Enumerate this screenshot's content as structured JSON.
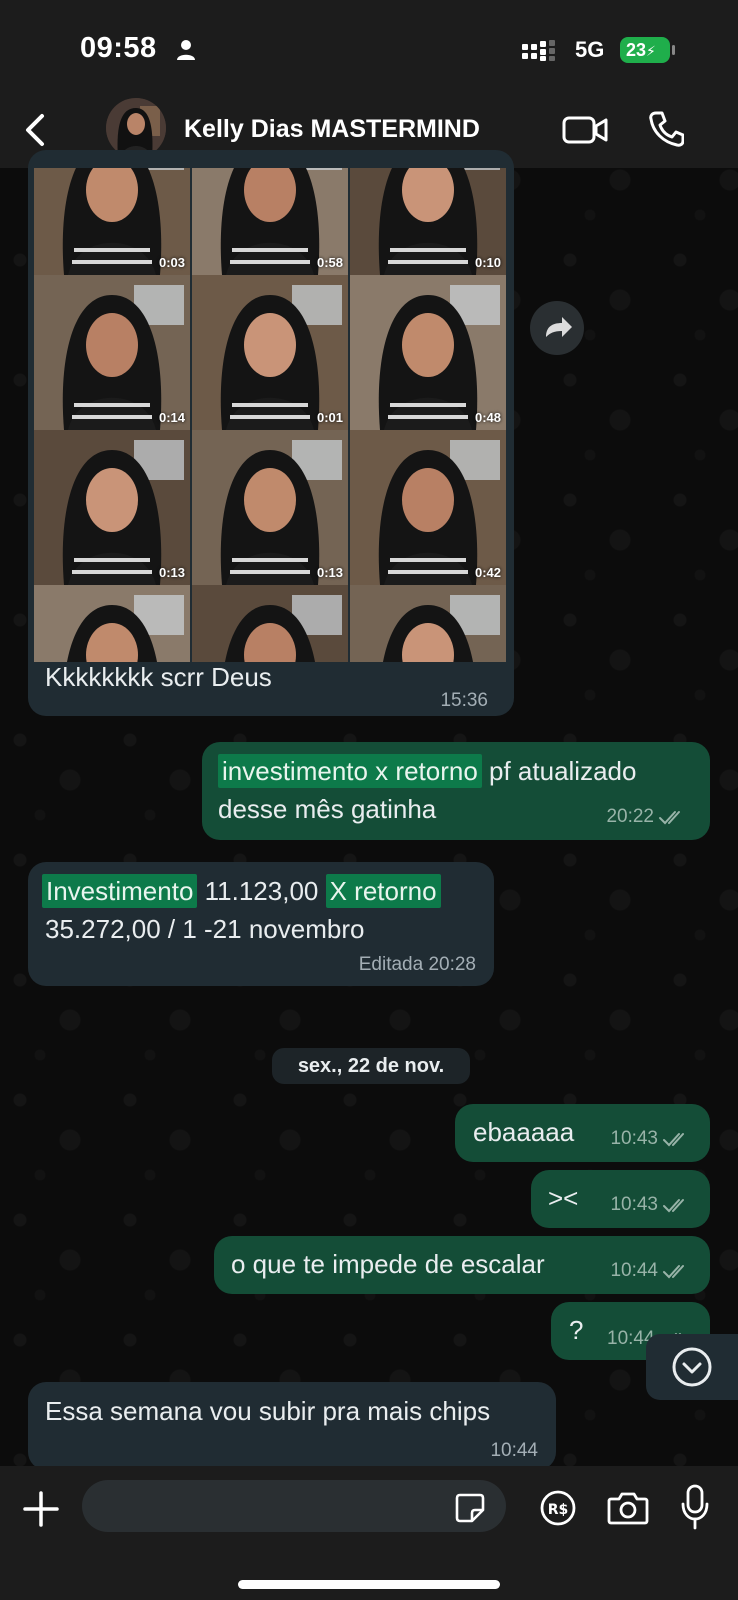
{
  "status_bar": {
    "time": "09:58",
    "network": "5G",
    "battery": "23",
    "icons": [
      "person-icon",
      "signal-icon",
      "battery-charging-icon"
    ]
  },
  "header": {
    "contact_name": "Kelly Dias MASTERMIND",
    "icons": [
      "back-chevron-icon",
      "avatar",
      "video-call-icon",
      "phone-icon"
    ]
  },
  "media_album": {
    "durations": [
      "0:03",
      "0:58",
      "0:10",
      "0:14",
      "0:01",
      "0:48",
      "0:13",
      "0:13",
      "0:42",
      "",
      "",
      ""
    ],
    "caption": "Kkkkkkkk scrr Deus",
    "time": "15:36"
  },
  "messages": [
    {
      "dir": "out",
      "highlight": "investimento x retorno",
      "text": " pf atualizado",
      "line2": "desse mês gatinha",
      "time": "20:22",
      "status": "read"
    },
    {
      "dir": "in",
      "highlight1": "Investimento",
      "mid": " 11.123,00 ",
      "highlight2": "X retorno",
      "line2": "35.272,00 / 1 -21 novembro",
      "time": "Editada 20:28"
    },
    {
      "dir": "out",
      "text": "ebaaaaa",
      "time": "10:43",
      "status": "read"
    },
    {
      "dir": "out",
      "text": "><",
      "time": "10:43",
      "status": "read"
    },
    {
      "dir": "out",
      "text": "o que te impede de escalar",
      "time": "10:44",
      "status": "read"
    },
    {
      "dir": "out",
      "text": "?",
      "time": "10:44",
      "status": "read"
    },
    {
      "dir": "in",
      "text": "Essa semana vou subir pra mais chips",
      "time": "10:44"
    }
  ],
  "date_separator": "sex., 22 de nov.",
  "input_bar": {
    "placeholder": "",
    "icons": [
      "plus-icon",
      "sticker-icon",
      "payment-icon",
      "camera-icon",
      "microphone-icon"
    ]
  },
  "colors": {
    "incoming_bubble": "#202c33",
    "outgoing_bubble": "#144d37",
    "highlight": "#0d7a4a",
    "battery": "#1fae4b"
  }
}
